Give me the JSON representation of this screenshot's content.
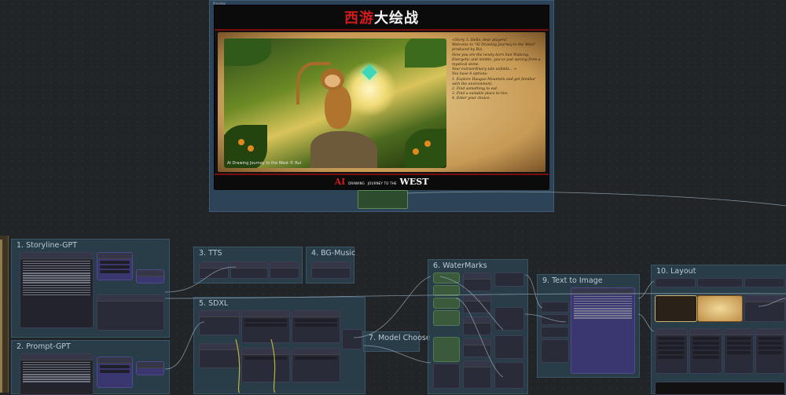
{
  "preview": {
    "window_label": "Preview",
    "poster": {
      "title_red": "西游",
      "title_white": "大绘战",
      "copyright": "AI Drawing Journey to the West © Rui",
      "story_lines": [
        "<Story 1: Hello, dear players!",
        "Welcome to \"AI Drawing Journey to the West\" produced by Rui.",
        "Now you are the newly born Sun Wukong,",
        "Energetic and nimble, you've just sprung from a mystical stone.",
        "Your extraordinary tale unfolds... >",
        "You have 4 options:",
        "1. Explore Huaguo Mountain and get familiar with the environment.",
        "2. Find something to eat.",
        "3. Find a suitable place to live.",
        "4. Enter your choice."
      ],
      "logo_ai": "AI",
      "logo_drawing": "DRAWING",
      "logo_subtitle": "JOURNEY TO THE",
      "logo_west": "WEST"
    }
  },
  "groups": {
    "storyline": "1. Storyline-GPT",
    "prompt": "2. Prompt-GPT",
    "tts": "3. TTS",
    "bgmusic": "4. BG-Music",
    "sdxl": "5. SDXL",
    "watermarks": "6. WaterMarks",
    "model_choose": "7. Model Choose",
    "text_to_image": "9. Text to Image",
    "layout": "10. Layout"
  },
  "colors": {
    "canvas": "#222527",
    "group": "#2d4658",
    "node": "#2a2b38",
    "wire_primary": "#9fb6c8",
    "wire_yellow": "#d6c93a",
    "title_red": "#d21c1c"
  }
}
